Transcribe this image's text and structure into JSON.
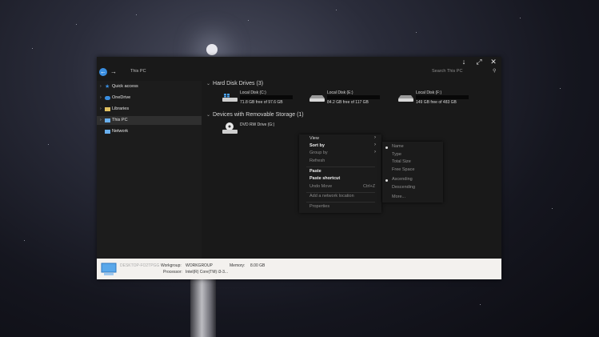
{
  "window": {
    "controls": {
      "minimize": "↓",
      "maximize": "⤢",
      "close": "✕"
    }
  },
  "navbar": {
    "address": "This PC",
    "search_placeholder": "Search This PC"
  },
  "sidebar": {
    "items": [
      {
        "label": "Quick access",
        "icon": "star-icon"
      },
      {
        "label": "OneDrive",
        "icon": "cloud-icon"
      },
      {
        "label": "Libraries",
        "icon": "folder-icon"
      },
      {
        "label": "This PC",
        "icon": "computer-icon",
        "selected": true
      },
      {
        "label": "Network",
        "icon": "network-icon"
      }
    ]
  },
  "content": {
    "hard_disks_header": "Hard Disk Drives (3)",
    "removable_header": "Devices with Removable Storage (1)",
    "disks": [
      {
        "name": "Local Disk (C:)",
        "free": "71.8 GB free of 97.6 GB",
        "icon": "windows-drive-icon"
      },
      {
        "name": "Local Disk (E:)",
        "free": "84.2 GB free of 117 GB",
        "icon": "drive-icon"
      },
      {
        "name": "Local Disk (F:)",
        "free": "149 GB free of 483 GB",
        "icon": "drive-icon"
      }
    ],
    "removable": [
      {
        "name": "DVD RW Drive (G:)",
        "icon": "dvd-drive-icon"
      }
    ]
  },
  "context_menu": {
    "items": [
      {
        "label": "View",
        "submenu": true
      },
      {
        "label": "Sort by",
        "submenu": true
      },
      {
        "label": "Group by",
        "submenu": true
      },
      {
        "label": "Refresh"
      },
      {
        "label": "Paste"
      },
      {
        "label": "Paste shortcut"
      },
      {
        "label": "Undo Move",
        "shortcut": "Ctrl+Z"
      },
      {
        "label": "Add a network location"
      },
      {
        "label": "Properties"
      }
    ]
  },
  "sort_submenu": {
    "items": [
      {
        "label": "Name",
        "checked": true
      },
      {
        "label": "Type"
      },
      {
        "label": "Total Size"
      },
      {
        "label": "Free Space"
      },
      {
        "label": "Ascending",
        "checked": true
      },
      {
        "label": "Descending"
      },
      {
        "label": "More..."
      }
    ]
  },
  "statusbar": {
    "computer_name": "DESKTOP-FO2TPGG",
    "workgroup_label": "Workgroup:",
    "workgroup_value": "WORKGROUP",
    "memory_label": "Memory:",
    "memory_value": "8.00 GB",
    "processor_label": "Processor:",
    "processor_value": "Intel(R) Core(TM) i3-3..."
  }
}
